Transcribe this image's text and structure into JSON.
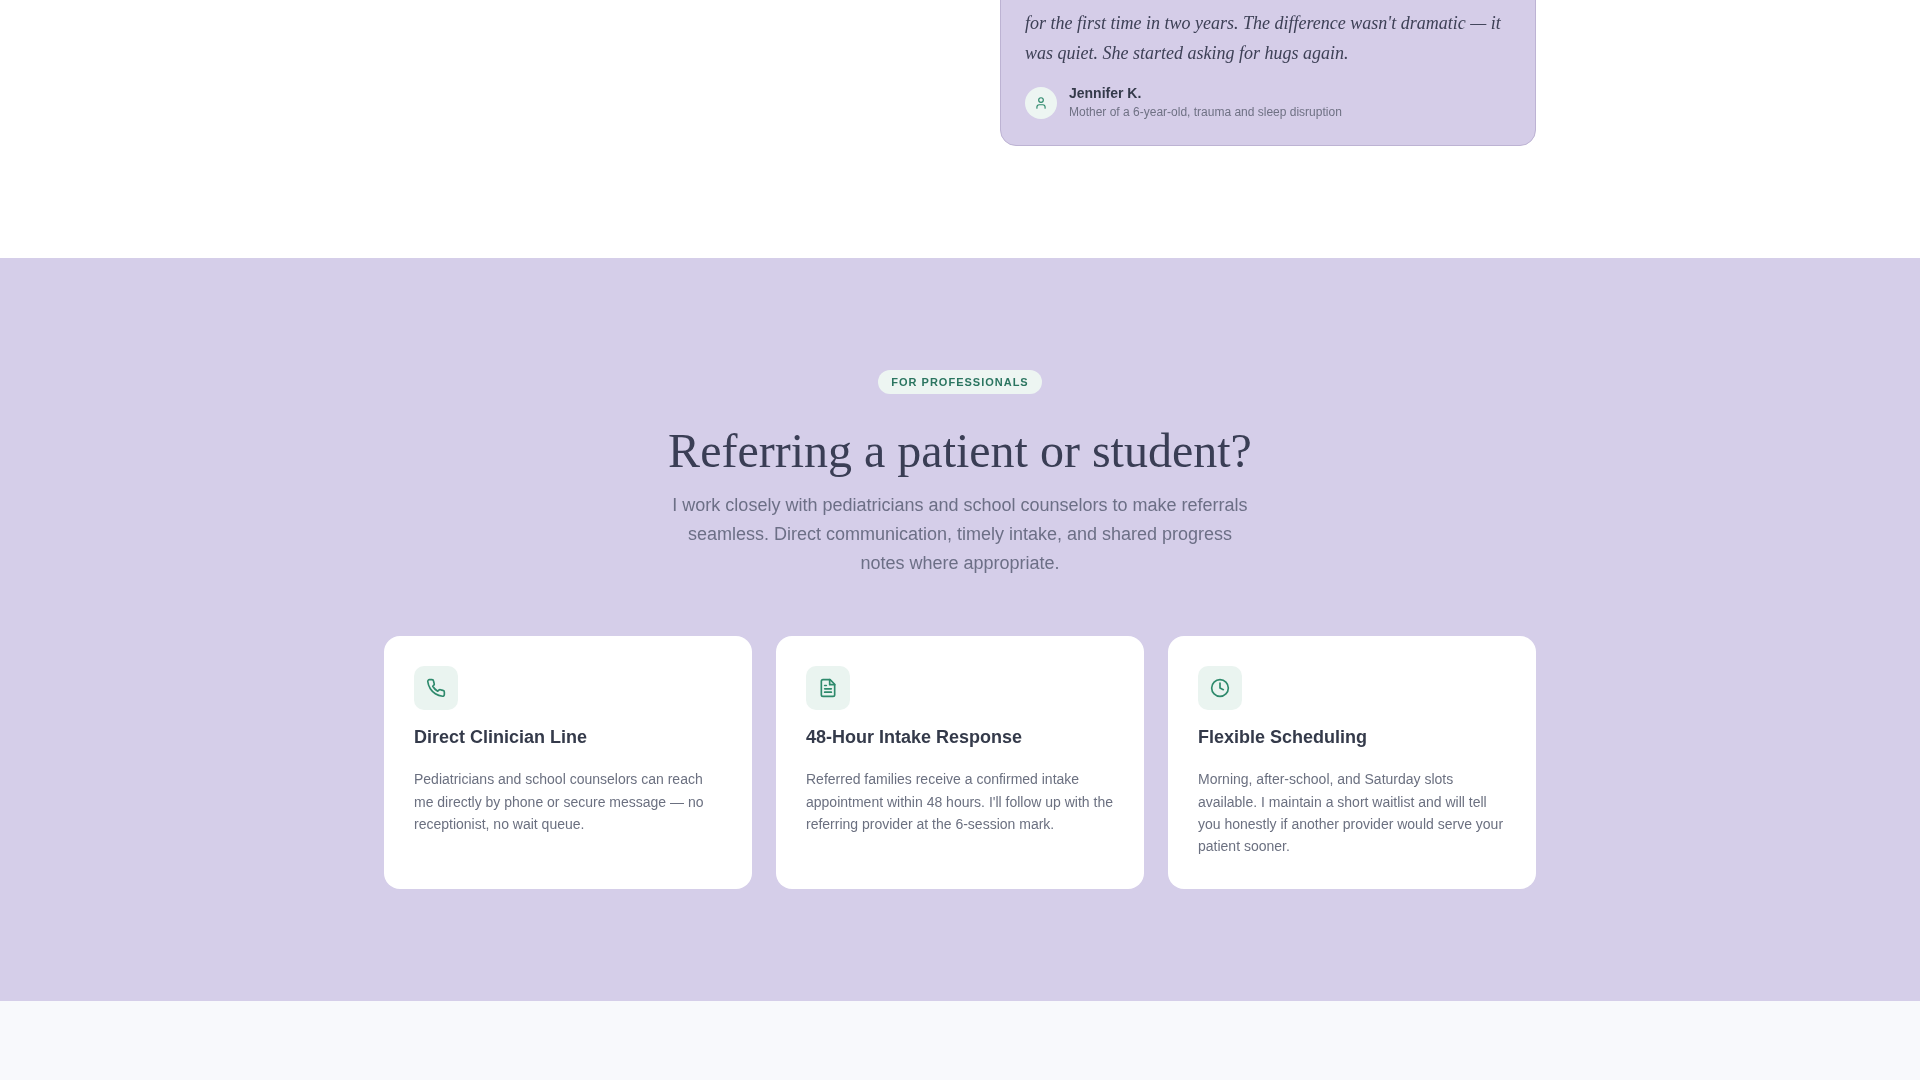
{
  "testimonial": {
    "quote": "for the first time in two years. The difference wasn't dramatic — it was quiet. She started asking for hugs again.",
    "author": "Jennifer K.",
    "author_detail": "Mother of a 6-year-old, trauma and sleep disruption"
  },
  "professionals": {
    "badge": "FOR PROFESSIONALS",
    "heading": "Referring a patient or student?",
    "intro": "I work closely with pediatricians and school counselors to make referrals seamless. Direct communication, timely intake, and shared progress notes where appropriate.",
    "cards": [
      {
        "title": "Direct Clinician Line",
        "text": "Pediatricians and school counselors can reach me directly by phone or secure message — no receptionist, no wait queue."
      },
      {
        "title": "48-Hour Intake Response",
        "text": "Referred families receive a confirmed intake appointment within 48 hours. I'll follow up with the referring provider at the 6-session mark."
      },
      {
        "title": "Flexible Scheduling",
        "text": "Morning, after-school, and Saturday slots available. I maintain a short waitlist and will tell you honestly if another provider would serve your patient sooner."
      }
    ]
  }
}
